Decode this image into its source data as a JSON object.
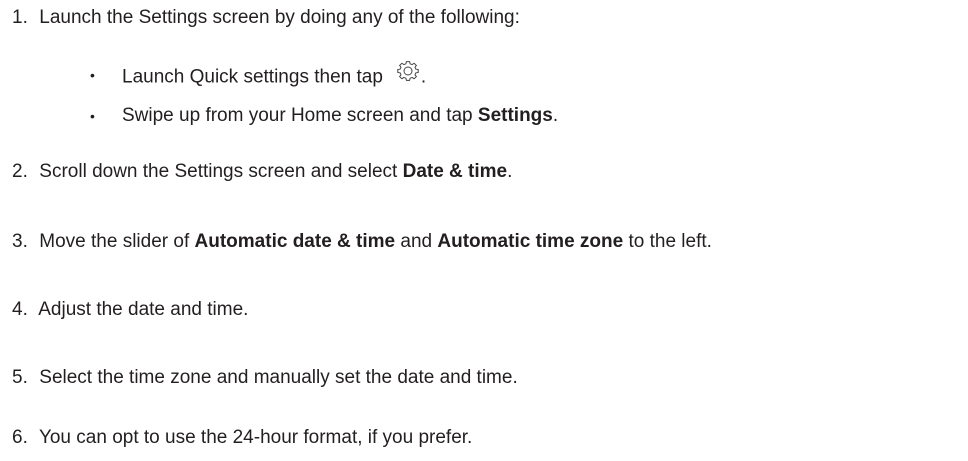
{
  "steps": [
    {
      "number": "1.",
      "text": "Launch the Settings screen by doing any of the following:",
      "bullets": [
        {
          "text_before": "Launch Quick settings then tap",
          "icon": "gear-icon",
          "text_after": "."
        },
        {
          "text_before": "Swipe up from your Home screen and tap ",
          "bold": "Settings",
          "text_after": "."
        }
      ]
    },
    {
      "number": "2.",
      "text_before": "Scroll down the Settings screen and select ",
      "bold": "Date & time",
      "text_after": "."
    },
    {
      "number": "3.",
      "text_before": "Move the slider of ",
      "bold": "Automatic date & time",
      "text_mid": " and ",
      "bold2": "Automatic time zone",
      "text_after": " to the left."
    },
    {
      "number": "4.",
      "text": "Adjust the date and time."
    },
    {
      "number": "5.",
      "text": "Select the time zone and manually set the date and time."
    },
    {
      "number": "6.",
      "text": "You can opt to use the 24-hour format, if you prefer."
    }
  ]
}
